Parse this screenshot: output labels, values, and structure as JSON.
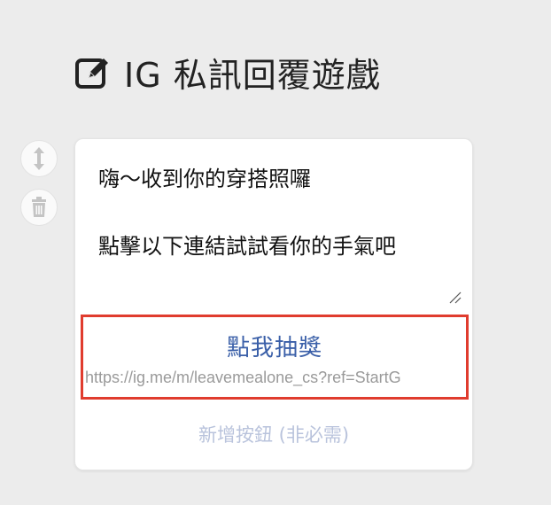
{
  "header": {
    "icon": "edit-icon",
    "title": "IG 私訊回覆遊戲"
  },
  "side_actions": {
    "move_icon": "move-vertical-icon",
    "delete_icon": "trash-icon"
  },
  "card": {
    "message": "嗨～收到你的穿搭照囉\n\n點擊以下連結試試看你的手氣吧",
    "button": {
      "label": "點我抽獎",
      "url": "https://ig.me/m/leavemealone_cs?ref=StartG"
    },
    "add_button_label": "新增按鈕 (非必需)"
  },
  "colors": {
    "highlight_border": "#e03c2e",
    "button_label": "#3a5fa8",
    "add_button": "#b9c3dc"
  }
}
